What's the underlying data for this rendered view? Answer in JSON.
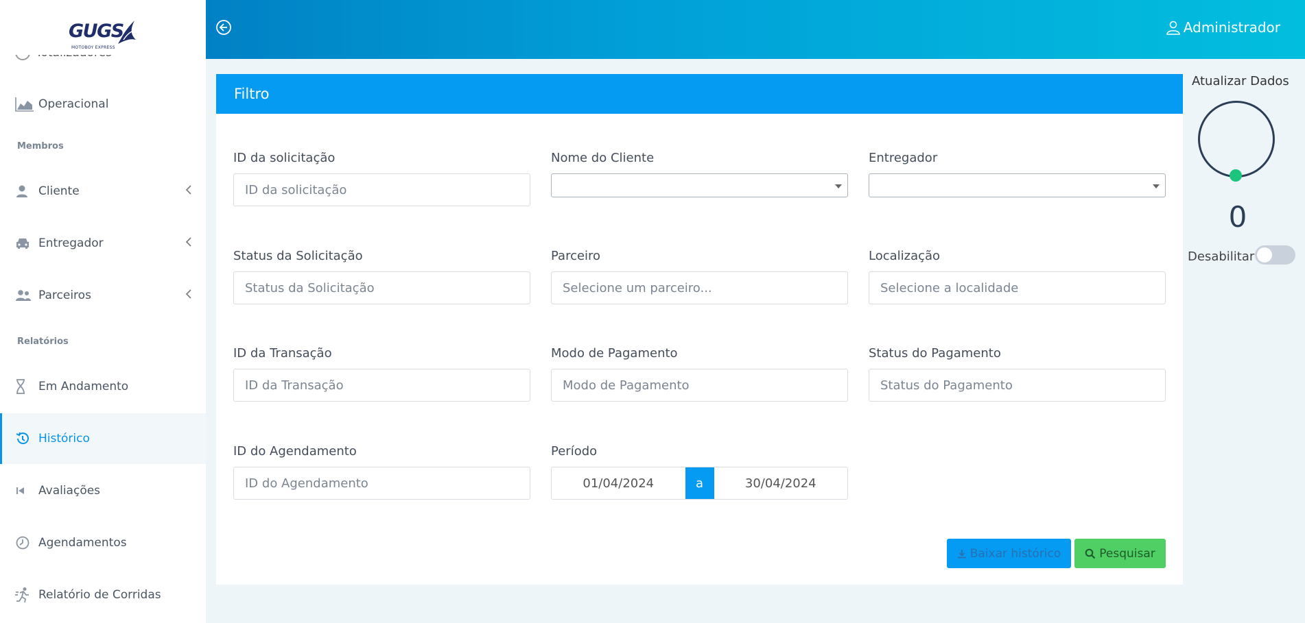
{
  "logo": {
    "name": "GUGS",
    "sub": "MOTOBOY EXPRESS"
  },
  "sidebar": {
    "cut_item": "Totalizadores",
    "items": [
      {
        "label": "Operacional",
        "icon": "area-chart-icon"
      },
      {
        "group": "Membros"
      },
      {
        "label": "Cliente",
        "icon": "user-icon"
      },
      {
        "label": "Entregador",
        "icon": "car-icon"
      },
      {
        "label": "Parceiros",
        "icon": "users-icon"
      },
      {
        "group": "Relatórios"
      },
      {
        "label": "Em Andamento",
        "icon": "hourglass-icon"
      },
      {
        "label": "Histórico",
        "icon": "history-icon"
      },
      {
        "label": "Avaliações",
        "icon": "step-backward-icon"
      },
      {
        "label": "Agendamentos",
        "icon": "clock-icon"
      },
      {
        "label": "Relatório de Corridas",
        "icon": "runner-icon"
      }
    ]
  },
  "header": {
    "user": "Administrador"
  },
  "filter": {
    "title": "Filtro",
    "fields": {
      "id_solicitacao": {
        "label": "ID da solicitação",
        "placeholder": "ID da solicitação"
      },
      "nome_cliente": {
        "label": "Nome do Cliente"
      },
      "entregador": {
        "label": "Entregador"
      },
      "status_solicitacao": {
        "label": "Status da Solicitação",
        "placeholder": "Status da Solicitação"
      },
      "parceiro": {
        "label": "Parceiro",
        "placeholder": "Selecione um parceiro..."
      },
      "localizacao": {
        "label": "Localização",
        "placeholder": "Selecione a localidade"
      },
      "id_transacao": {
        "label": "ID da Transação",
        "placeholder": "ID da Transação"
      },
      "modo_pagamento": {
        "label": "Modo de Pagamento",
        "placeholder": "Modo de Pagamento"
      },
      "status_pagamento": {
        "label": "Status do Pagamento",
        "placeholder": "Status do Pagamento"
      },
      "id_agendamento": {
        "label": "ID do Agendamento",
        "placeholder": "ID do Agendamento"
      },
      "periodo": {
        "label": "Período",
        "start": "01/04/2024",
        "separator": "a",
        "end": "30/04/2024"
      }
    },
    "buttons": {
      "download": "Baixar histórico",
      "search": "Pesquisar"
    }
  },
  "refresh": {
    "title": "Atualizar Dados",
    "count": "0",
    "disable_label": "Desabilitar"
  },
  "colors": {
    "accent": "#059bf3",
    "success": "#4fcf64",
    "ring_dot": "#1dc47e"
  }
}
